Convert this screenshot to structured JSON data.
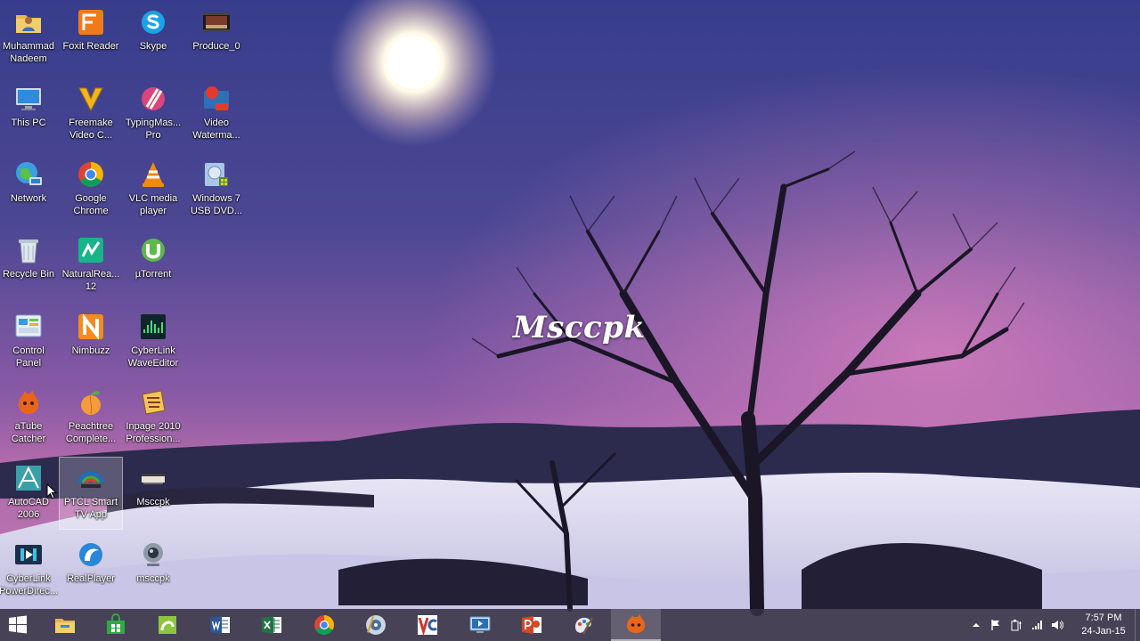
{
  "wallpaper": {
    "watermark_text": "Msccpk"
  },
  "desktop": {
    "icons": [
      {
        "label": "Muhammad\nNadeem",
        "icon": "user-folder-icon"
      },
      {
        "label": "This PC",
        "icon": "computer-icon"
      },
      {
        "label": "Network",
        "icon": "network-globe-icon"
      },
      {
        "label": "Recycle Bin",
        "icon": "recycle-bin-icon"
      },
      {
        "label": "Control\nPanel",
        "icon": "control-panel-icon"
      },
      {
        "label": "aTube\nCatcher",
        "icon": "atube-catcher-icon"
      },
      {
        "label": "AutoCAD\n2006",
        "icon": "autocad-icon"
      },
      {
        "label": "CyberLink\nPowerDirec...",
        "icon": "powerdirector-icon"
      },
      {
        "label": "Foxit Reader",
        "icon": "foxit-reader-icon"
      },
      {
        "label": "Freemake\nVideo C...",
        "icon": "freemake-icon"
      },
      {
        "label": "Google\nChrome",
        "icon": "chrome-icon"
      },
      {
        "label": "NaturalRea...\n12",
        "icon": "naturalreader-icon"
      },
      {
        "label": "Nimbuzz",
        "icon": "nimbuzz-icon"
      },
      {
        "label": "Peachtree\nComplete...",
        "icon": "peachtree-icon"
      },
      {
        "label": "PTCL Smart\nTV App",
        "icon": "ptcl-smart-tv-icon"
      },
      {
        "label": "RealPlayer",
        "icon": "realplayer-icon"
      },
      {
        "label": "Skype",
        "icon": "skype-icon"
      },
      {
        "label": "TypingMas...\nPro",
        "icon": "typingmaster-icon"
      },
      {
        "label": "VLC media\nplayer",
        "icon": "vlc-icon"
      },
      {
        "label": "µTorrent",
        "icon": "utorrent-icon"
      },
      {
        "label": "CyberLink\nWaveEditor",
        "icon": "waveeditor-icon"
      },
      {
        "label": "Inpage 2010\nProfession...",
        "icon": "inpage-icon"
      },
      {
        "label": "Msccpk",
        "icon": "msccpk-video-icon"
      },
      {
        "label": "msccpk",
        "icon": "webcam-icon"
      },
      {
        "label": "Produce_0",
        "icon": "video-thumbnail-icon"
      },
      {
        "label": "Video\nWaterma...",
        "icon": "video-watermark-icon"
      },
      {
        "label": "Windows 7\nUSB DVD...",
        "icon": "usb-dvd-tool-icon"
      }
    ]
  },
  "taskbar": {
    "buttons": [
      {
        "name": "start",
        "icon": "windows-start-icon"
      },
      {
        "name": "file-explorer",
        "icon": "folder-icon"
      },
      {
        "name": "store",
        "icon": "store-icon"
      },
      {
        "name": "camtasia",
        "icon": "camtasia-icon"
      },
      {
        "name": "word",
        "icon": "word-icon"
      },
      {
        "name": "excel",
        "icon": "excel-icon"
      },
      {
        "name": "chrome",
        "icon": "chrome-icon"
      },
      {
        "name": "media-app",
        "icon": "media-disc-icon"
      },
      {
        "name": "vc-app",
        "icon": "vc-app-icon"
      },
      {
        "name": "video-app",
        "icon": "screen-video-icon"
      },
      {
        "name": "powerpoint",
        "icon": "powerpoint-icon"
      },
      {
        "name": "paint-app",
        "icon": "paint-icon"
      },
      {
        "name": "atube-catcher",
        "icon": "atube-catcher-icon"
      }
    ],
    "tray": {
      "icons": [
        "show-hidden-icons-icon",
        "flag-icon",
        "battery-plug-icon",
        "signal-bars-icon",
        "volume-icon"
      ],
      "time": "7:57 PM",
      "date": "24-Jan-15"
    }
  },
  "colors": {
    "sky_top": "#3b3f8f",
    "sky_mid": "#6a4e9a",
    "sky_horizon": "#c778b4",
    "snow": "#dcd9ef",
    "taskbar": "#343042"
  }
}
